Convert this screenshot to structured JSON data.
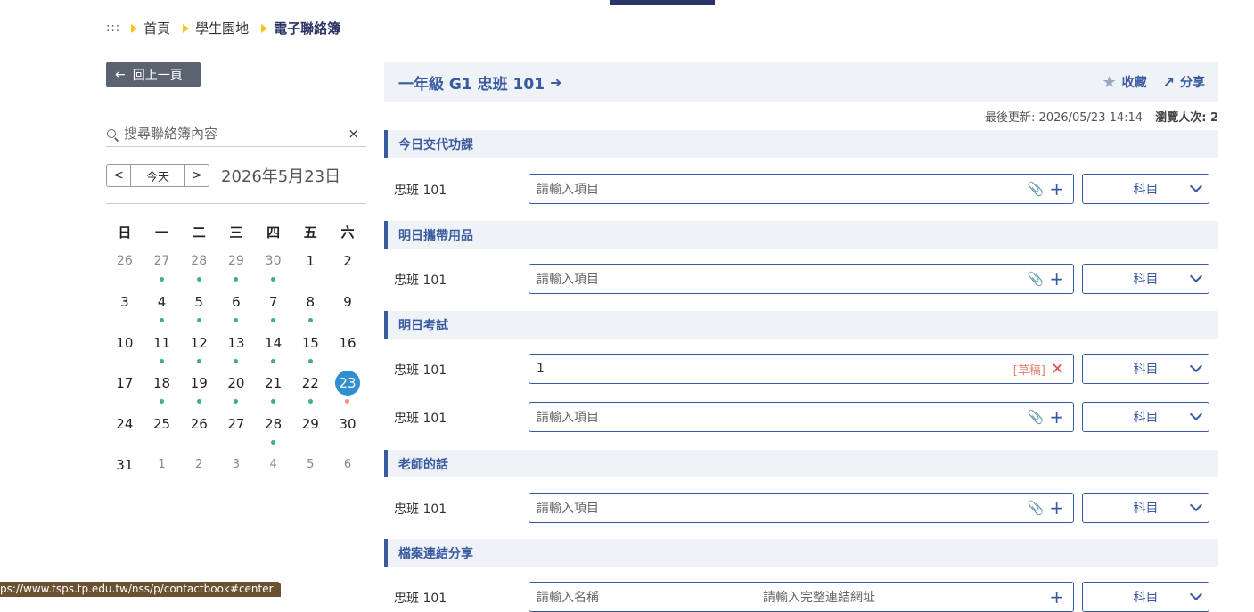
{
  "breadcrumb": {
    "dots": ":::",
    "items": [
      "首頁",
      "學生園地",
      "電子聯絡簿"
    ]
  },
  "back_button": {
    "label": "回上一頁"
  },
  "search": {
    "placeholder": "搜尋聯絡簿內容",
    "clear_label": "×"
  },
  "date_nav": {
    "prev": "<",
    "today": "今天",
    "next": ">",
    "current_date": "2026年5月23日"
  },
  "calendar": {
    "weekdays": [
      "日",
      "一",
      "二",
      "三",
      "四",
      "五",
      "六"
    ],
    "weeks": [
      [
        "26",
        "27",
        "28",
        "29",
        "30",
        "1",
        "2"
      ],
      [
        "3",
        "4",
        "5",
        "6",
        "7",
        "8",
        "9"
      ],
      [
        "10",
        "11",
        "12",
        "13",
        "14",
        "15",
        "16"
      ],
      [
        "17",
        "18",
        "19",
        "20",
        "21",
        "22",
        "23"
      ],
      [
        "24",
        "25",
        "26",
        "27",
        "28",
        "29",
        "30"
      ],
      [
        "31",
        "1",
        "2",
        "3",
        "4",
        "5",
        "6"
      ]
    ],
    "today": "23",
    "dot_color": "#3fae8c",
    "today_color": "#2f8fd1"
  },
  "panel": {
    "title": "一年級 G1 忠班 101",
    "favorite_label": "收藏",
    "share_label": "分享",
    "last_updated": "最後更新: 2026/05/23 14:14",
    "views": "瀏覽人次: 2"
  },
  "sections": [
    {
      "title": "今日交代功課",
      "rows": [
        {
          "label": "忠班 101",
          "value": "請輸入項目",
          "subject": "科目"
        }
      ]
    },
    {
      "title": "明日攜帶用品",
      "rows": [
        {
          "label": "忠班 101",
          "value": "請輸入項目",
          "subject": "科目"
        }
      ]
    },
    {
      "title": "明日考試",
      "rows": [
        {
          "label": "忠班 101",
          "value": "1",
          "draft": "[草稿]",
          "subject": "科目"
        },
        {
          "label": "忠班 101",
          "value": "請輸入項目",
          "subject": "科目"
        }
      ]
    },
    {
      "title": "老師的話",
      "rows": [
        {
          "label": "忠班 101",
          "value": "請輸入項目",
          "subject": "科目"
        }
      ]
    },
    {
      "title": "檔案連結分享",
      "rows": [
        {
          "label": "忠班 101",
          "name_placeholder": "請輸入名稱",
          "url_placeholder": "請輸入完整連結網址",
          "subject": "科目"
        }
      ]
    }
  ],
  "status_bar": {
    "url": "ps://www.tsps.tp.edu.tw/nss/p/contactbook#center"
  }
}
